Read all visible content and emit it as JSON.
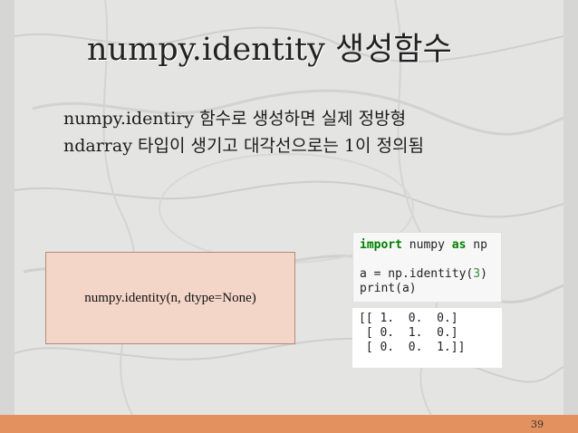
{
  "slide": {
    "title": "numpy.identity 생성함수",
    "body_line_1": "numpy.identiry 함수로 생성하면 실제 정방형",
    "body_line_2": "ndarray 타입이 생기고 대각선으로는 1이 정의됨",
    "syntax_box_text": "numpy.identity(n, dtype=None)",
    "code": {
      "line1_kw_import": "import",
      "line1_module": " numpy ",
      "line1_kw_as": "as",
      "line1_alias": " np",
      "line2_prefix": "a = np.identity(",
      "line2_arg": "3",
      "line2_suffix": ")",
      "line3": "print(a)"
    },
    "output": {
      "row1": "[[ 1.  0.  0.]",
      "row2": " [ 0.  1.  0.]",
      "row3": " [ 0.  0.  1.]]"
    },
    "page_number": "39"
  },
  "colors": {
    "footer_bar": "#e2915f",
    "syntax_box_fill": "#f4d6c9",
    "syntax_box_border": "#b48a7c",
    "keyword_green": "#008000",
    "number_green": "#3b8a3b"
  }
}
